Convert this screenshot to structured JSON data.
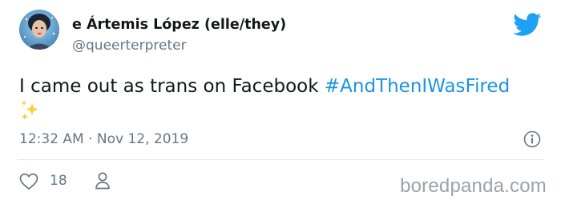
{
  "tweet": {
    "author_name": "e Ártemis López (elle/they)",
    "author_handle": "@queerterpreter",
    "text_before_hashtag": "I came out as trans on Facebook ",
    "hashtag": "#AndThenIWasFired",
    "emoji": "sparkles",
    "timestamp": "12:32 AM · Nov 12, 2019"
  },
  "engagement": {
    "like_count": "18"
  },
  "icons": {
    "brand": "twitter-bird-icon",
    "info": "info-icon",
    "like": "heart-icon",
    "profile": "person-icon"
  },
  "colors": {
    "brand_blue": "#1da1f2",
    "hashtag_blue": "#1b95e0",
    "text_primary": "#14171a",
    "text_secondary": "#657786",
    "sparkle_yellow": "#ffcc33"
  },
  "watermark": {
    "text": "boredpanda.com"
  }
}
